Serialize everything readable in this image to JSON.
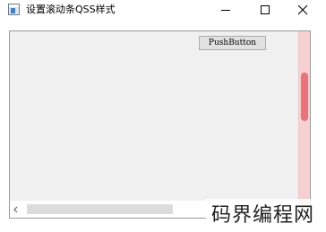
{
  "window": {
    "title": "设置滚动条QSS样式"
  },
  "content": {
    "push_button_label": "PushButton"
  },
  "scrollbar": {
    "vertical_color": "#e8737b",
    "vertical_track_color": "#f7d0d2"
  },
  "watermark": {
    "text": "码界编程网"
  },
  "icons": [
    "app-icon",
    "minimize-icon",
    "maximize-icon",
    "close-icon",
    "chevron-left-icon"
  ]
}
